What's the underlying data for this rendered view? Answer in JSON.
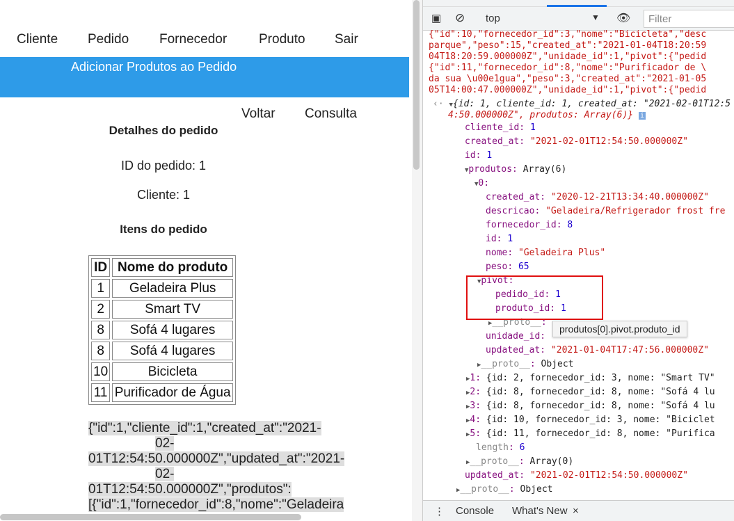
{
  "nav": [
    "Cliente",
    "Pedido",
    "Fornecedor",
    "Produto",
    "Sair"
  ],
  "banner": "Adicionar Produtos ao Pedido",
  "links": {
    "back": "Voltar",
    "query": "Consulta"
  },
  "details": {
    "title": "Detalhes do pedido",
    "order_id": "ID do pedido: 1",
    "client": "Cliente: 1",
    "items_title": "Itens do pedido"
  },
  "table": {
    "headers": [
      "ID",
      "Nome do produto"
    ],
    "rows": [
      [
        "1",
        "Geladeira Plus"
      ],
      [
        "2",
        "Smart TV"
      ],
      [
        "8",
        "Sofá 4 lugares"
      ],
      [
        "8",
        "Sofá 4 lugares"
      ],
      [
        "10",
        "Bicicleta"
      ],
      [
        "11",
        "Purificador de Água"
      ]
    ]
  },
  "json_dump": [
    "{\"id\":1,\"cliente_id\":1,\"created_at\":\"2021-",
    "02-",
    "01T12:54:50.000000Z\",\"updated_at\":\"2021-",
    "02-",
    "01T12:54:50.000000Z\",\"produtos\":",
    "[{\"id\":1,\"fornecedor_id\":8,\"nome\":\"Geladeira"
  ],
  "devtools": {
    "context": "top",
    "filter_placeholder": "Filter",
    "raw": [
      "{\"id\":10,\"fornecedor_id\":3,\"nome\":\"Bicicleta\",\"desc",
      "parque\",\"peso\":15,\"created_at\":\"2021-01-04T18:20:59",
      "04T18:20:59.000000Z\",\"unidade_id\":1,\"pivot\":{\"pedid",
      "{\"id\":11,\"fornecedor_id\":8,\"nome\":\"Purificador de \\",
      "da sua \\u00e1gua\",\"peso\":3,\"created_at\":\"2021-01-05",
      "05T14:00:47.000000Z\",\"unidade_id\":1,\"pivot\":{\"pedid"
    ],
    "summary1": "{id: 1, cliente_id: 1, created_at: \"2021-02-01T12:5",
    "summary2": "4:50.000000Z\", produtos: Array(6)}",
    "tree": [
      {
        "k": "cliente_id",
        "v": "1",
        "t": "n"
      },
      {
        "k": "created_at",
        "v": "\"2021-02-01T12:54:50.000000Z\"",
        "t": "s"
      },
      {
        "k": "id",
        "v": "1",
        "t": "n"
      },
      {
        "k": "produtos",
        "v": "Array(6)",
        "t": "p"
      },
      {
        "k": "0",
        "v": "",
        "t": "p"
      },
      {
        "k": "created_at",
        "v": "\"2020-12-21T13:34:40.000000Z\"",
        "t": "s"
      },
      {
        "k": "descricao",
        "v": "\"Geladeira/Refrigerador frost fre",
        "t": "s"
      },
      {
        "k": "fornecedor_id",
        "v": "8",
        "t": "n"
      },
      {
        "k": "id",
        "v": "1",
        "t": "n"
      },
      {
        "k": "nome",
        "v": "\"Geladeira Plus\"",
        "t": "s"
      },
      {
        "k": "peso",
        "v": "65",
        "t": "n"
      },
      {
        "k": "pivot",
        "v": "",
        "t": "p"
      },
      {
        "k": "pedido_id",
        "v": "1",
        "t": "n"
      },
      {
        "k": "produto_id",
        "v": "1",
        "t": "n"
      },
      {
        "k": "__proto__",
        "v": "",
        "t": "p"
      },
      {
        "k": "unidade_id",
        "v": "",
        "t": "n"
      },
      {
        "k": "updated_at",
        "v": "\"2021-01-04T17:47:56.000000Z\"",
        "t": "s"
      },
      {
        "k": "__proto__",
        "v": "Object",
        "t": "p"
      },
      {
        "k": "1",
        "v": "{id: 2, fornecedor_id: 3, nome: \"Smart TV\"",
        "t": "p"
      },
      {
        "k": "2",
        "v": "{id: 8, fornecedor_id: 8, nome: \"Sofá 4 lu",
        "t": "p"
      },
      {
        "k": "3",
        "v": "{id: 8, fornecedor_id: 8, nome: \"Sofá 4 lu",
        "t": "p"
      },
      {
        "k": "4",
        "v": "{id: 10, fornecedor_id: 3, nome: \"Biciclet",
        "t": "p"
      },
      {
        "k": "5",
        "v": "{id: 11, fornecedor_id: 8, nome: \"Purifica",
        "t": "p"
      },
      {
        "k": "length",
        "v": "6",
        "t": "n"
      },
      {
        "k": "__proto__",
        "v": "Array(0)",
        "t": "p"
      },
      {
        "k": "updated_at",
        "v": "\"2021-02-01T12:54:50.000000Z\"",
        "t": "s"
      },
      {
        "k": "__proto__",
        "v": "Object",
        "t": "p"
      }
    ],
    "tooltip": "produtos[0].pivot.produto_id",
    "bottom_tabs": [
      "Console",
      "What's New"
    ]
  }
}
